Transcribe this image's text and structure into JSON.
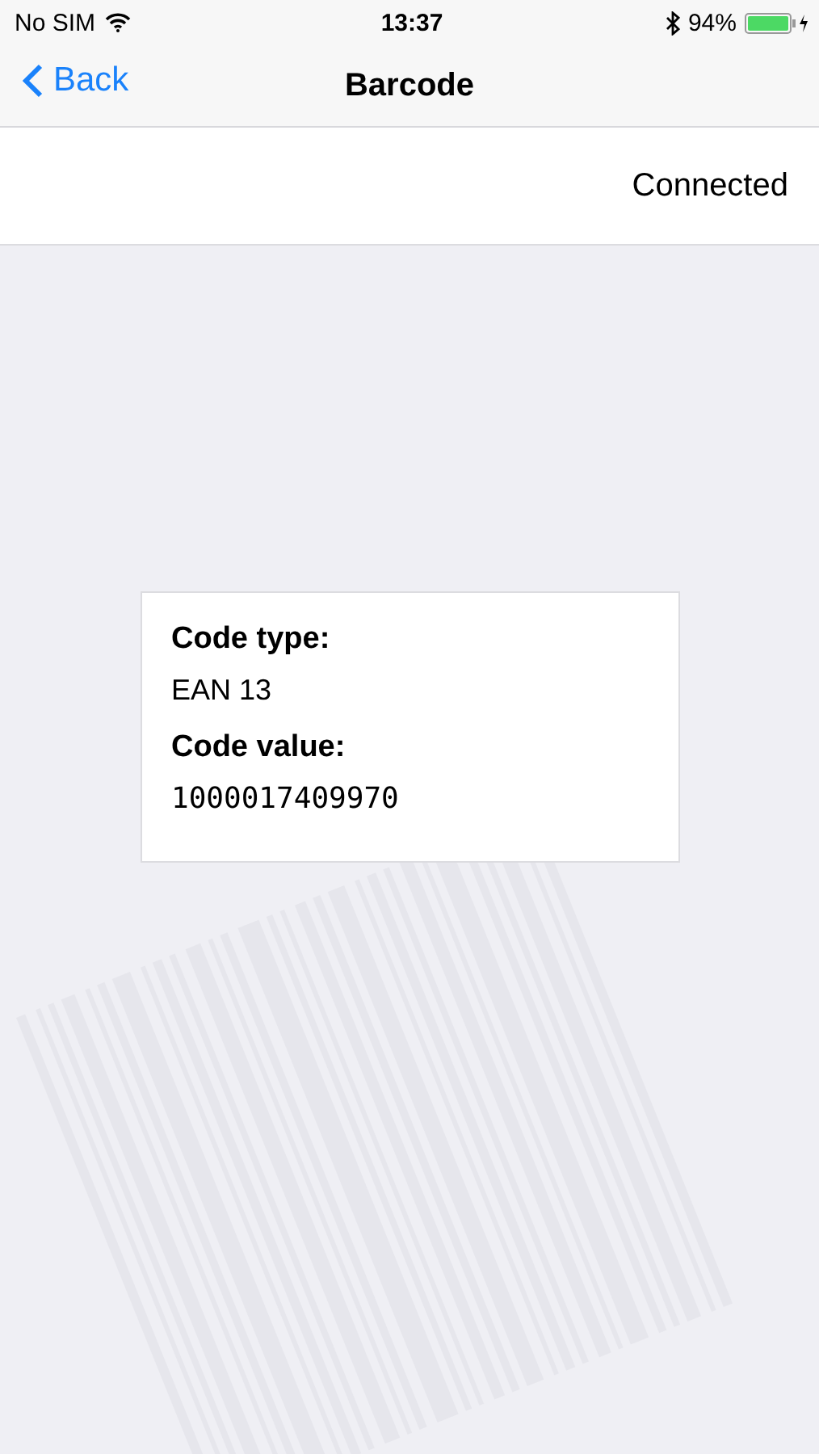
{
  "status_bar": {
    "carrier": "No SIM",
    "time": "13:37",
    "battery": "94%"
  },
  "nav_bar": {
    "back": "Back",
    "title": "Barcode"
  },
  "connection": {
    "status": "Connected"
  },
  "result": {
    "fields": [
      {
        "label": "Code type:",
        "value": "EAN 13",
        "kind": "plain"
      },
      {
        "label": "Code value:",
        "value": "1000017409970",
        "kind": "mono"
      }
    ]
  }
}
